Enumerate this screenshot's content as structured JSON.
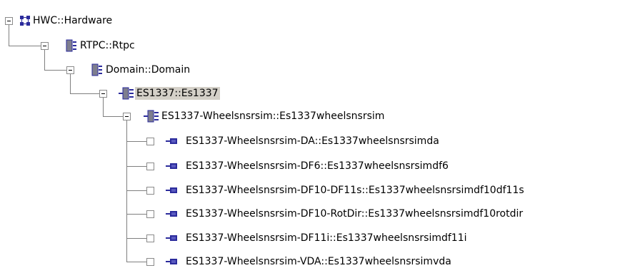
{
  "tree": {
    "nodes": [
      {
        "label": "HWC::Hardware",
        "icon": "hardware-network-icon",
        "state": "expanded"
      },
      {
        "label": "RTPC::Rtpc",
        "icon": "rtpc-module-icon",
        "state": "expanded"
      },
      {
        "label": "Domain::Domain",
        "icon": "domain-module-icon",
        "state": "expanded"
      },
      {
        "label": "ES1337::Es1337",
        "icon": "board-connector-icon",
        "state": "expanded",
        "selected": true
      },
      {
        "label": "ES1337-Wheelsnsrsim::Es1337wheelsnsrsim",
        "icon": "board-connector-icon",
        "state": "expanded"
      },
      {
        "label": "ES1337-Wheelsnsrsim-DA::Es1337wheelsnsrsimda",
        "icon": "channel-icon",
        "state": "leaf"
      },
      {
        "label": "ES1337-Wheelsnsrsim-DF6::Es1337wheelsnsrsimdf6",
        "icon": "channel-icon",
        "state": "leaf"
      },
      {
        "label": "ES1337-Wheelsnsrsim-DF10-DF11s::Es1337wheelsnsrsimdf10df11s",
        "icon": "channel-icon",
        "state": "leaf"
      },
      {
        "label": "ES1337-Wheelsnsrsim-DF10-RotDir::Es1337wheelsnsrsimdf10rotdir",
        "icon": "channel-icon",
        "state": "leaf"
      },
      {
        "label": "ES1337-Wheelsnsrsim-DF11i::Es1337wheelsnsrsimdf11i",
        "icon": "channel-icon",
        "state": "leaf"
      },
      {
        "label": "ES1337-Wheelsnsrsim-VDA::Es1337wheelsnsrsimvda",
        "icon": "channel-icon",
        "state": "leaf"
      }
    ],
    "colors": {
      "icon_blue": "#2b2b9c",
      "icon_gray": "#7e7e8e",
      "connector": "#8a8a8a",
      "selection": "#d4d0c8"
    }
  }
}
